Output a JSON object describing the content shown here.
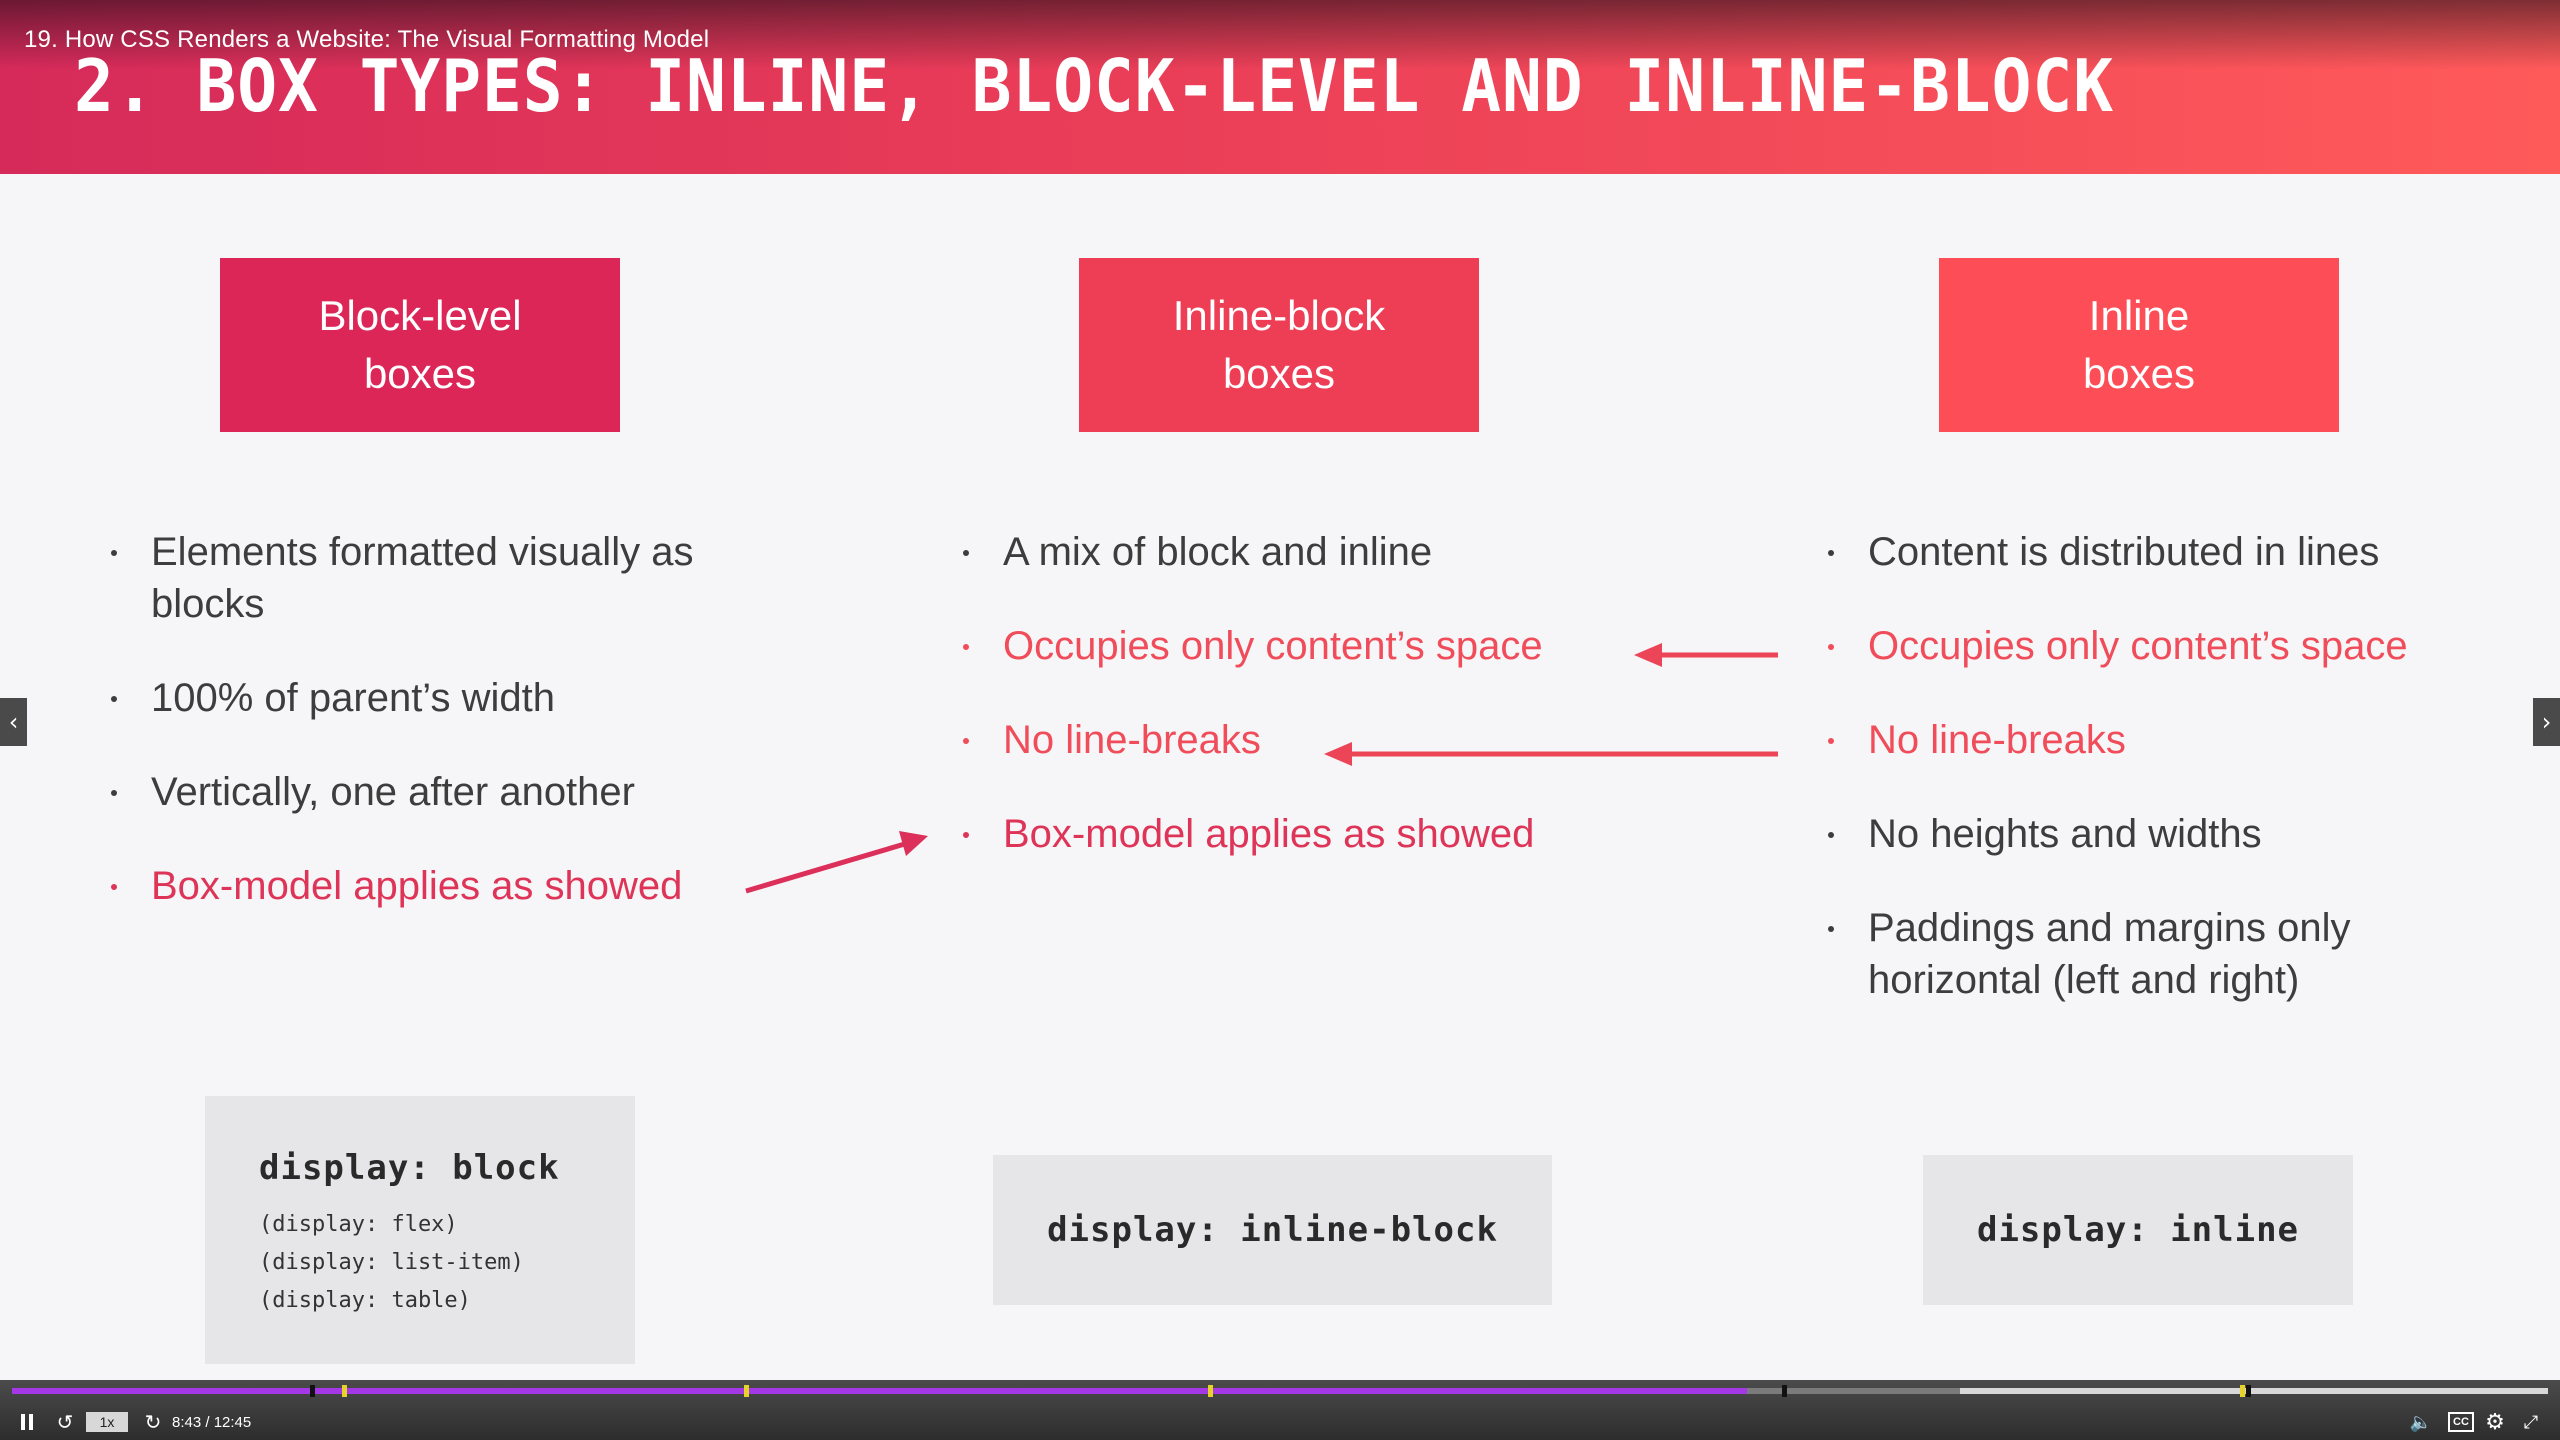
{
  "header": {
    "video_title": "19. How CSS Renders a Website: The Visual Formatting Model",
    "slide_title": "2. BOX TYPES: INLINE, BLOCK-LEVEL AND INLINE-BLOCK"
  },
  "columns": {
    "block": {
      "label_line1": "Block-level",
      "label_line2": "boxes",
      "bullets": [
        "Elements formatted visually as blocks",
        "100% of parent’s width",
        "Vertically, one after another",
        "Box-model applies as showed"
      ],
      "code": {
        "main": "display: block",
        "sub": [
          "(display: flex)",
          "(display: list-item)",
          "(display: table)"
        ]
      }
    },
    "inline_block": {
      "label_line1": "Inline-block",
      "label_line2": "boxes",
      "bullets": [
        "A mix of block and inline",
        "Occupies only content’s space",
        "No line-breaks",
        "Box-model applies as showed"
      ],
      "code": {
        "main": "display: inline-block"
      }
    },
    "inline": {
      "label_line1": "Inline",
      "label_line2": "boxes",
      "bullets": [
        "Content is distributed in lines",
        "Occupies only content’s space",
        "No line-breaks",
        "No heights and widths",
        "Paddings and margins only horizontal (left and right)"
      ],
      "code": {
        "main": "display: inline"
      }
    }
  },
  "colors": {
    "accent_dark": "#db2657",
    "accent_mid": "#ee3e56",
    "accent_light": "#fd4d56",
    "progress": "#a437e6"
  },
  "player": {
    "speed": "1x",
    "time": "8:43 / 12:45",
    "progress_fraction": 0.684,
    "icons": [
      "pause-icon",
      "rewind-icon",
      "forward-icon",
      "volume-icon",
      "cc-icon",
      "settings-icon",
      "fullscreen-icon"
    ]
  },
  "nav": {
    "prev_icon": "chevron-left-icon",
    "next_icon": "chevron-right-icon"
  }
}
